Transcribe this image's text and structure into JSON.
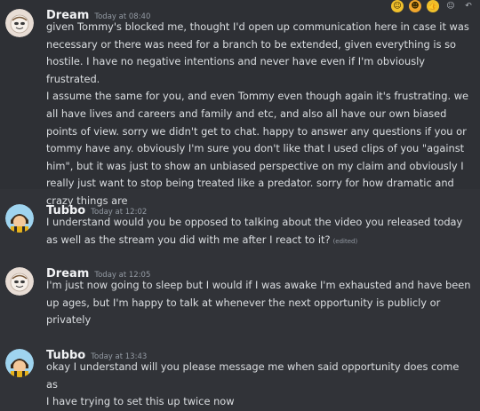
{
  "messages": [
    {
      "author": "Dream",
      "timestamp": "Today at 08:40",
      "lines": [
        "given Tommy's blocked me, thought I'd open up communication here in case it was",
        "necessary or there was need for a branch to be extended, given everything is so",
        "hostile. I have no negative intentions and never have even if I'm obviously frustrated.",
        "I assume the same for you, and even Tommy even though again it's frustrating. we",
        "all have lives and careers and family and etc, and also all have our own biased",
        "points of view. sorry we didn't get to chat. happy to answer any questions if you or",
        "tommy have any. obviously I'm sure you don't like that I used clips of you \"against",
        "him\", but it was just to show an unbiased perspective on my claim and obviously I",
        "really just want to stop being treated like a predator. sorry for how dramatic and",
        "crazy things are"
      ]
    },
    {
      "author": "Tubbo",
      "timestamp": "Today at 12:02",
      "lines": [
        "I understand would you be opposed to talking about the video you released today",
        "as well as the stream you did with me after I react to it?"
      ],
      "edited": "(edited)"
    },
    {
      "author": "Dream",
      "timestamp": "Today at 12:05",
      "lines": [
        "I'm just now going to sleep but I would if I was awake I'm exhausted and have been",
        "up ages, but I'm happy to talk at whenever the next opportunity is publicly or",
        "privately"
      ]
    },
    {
      "author": "Tubbo",
      "timestamp": "Today at 13:43",
      "lines": [
        "okay I understand will you please message me when said opportunity does come as",
        "I have trying to set this up twice now"
      ]
    }
  ],
  "toolbar": {
    "icons": [
      "add-reaction-icon",
      "emoji-icon",
      "thumbs-up-icon",
      "reply-icon",
      "more-icon"
    ]
  },
  "colors": {
    "background": "#313338",
    "author": "#f2f3f5",
    "text": "#dbdee1",
    "timestamp": "#949ba4"
  }
}
